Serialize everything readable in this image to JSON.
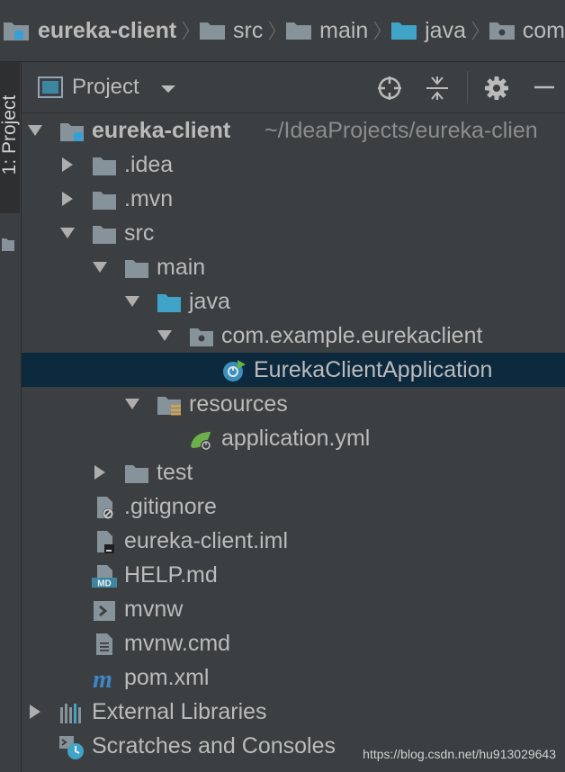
{
  "breadcrumb": {
    "items": [
      {
        "label": "eureka-client",
        "icon": "module-folder-icon"
      },
      {
        "label": "src",
        "icon": "folder-icon"
      },
      {
        "label": "main",
        "icon": "folder-icon"
      },
      {
        "label": "java",
        "icon": "source-folder-icon"
      },
      {
        "label": "com",
        "icon": "package-icon"
      }
    ]
  },
  "tool_window": {
    "tab_label": "1: Project"
  },
  "project_header": {
    "title": "Project",
    "buttons": [
      "locate-icon",
      "collapse-all-icon",
      "gear-icon",
      "hide-icon"
    ]
  },
  "tree": {
    "root": {
      "label": "eureka-client",
      "path": "~/IdeaProjects/eureka-clien"
    },
    "idea": ".idea",
    "mvn": ".mvn",
    "src": "src",
    "main": "main",
    "java": "java",
    "package": "com.example.eurekaclient",
    "app_class": "EurekaClientApplication",
    "resources": "resources",
    "app_yml": "application.yml",
    "test": "test",
    "gitignore": ".gitignore",
    "iml": "eureka-client.iml",
    "help": "HELP.md",
    "mvnw": "mvnw",
    "mvnw_cmd": "mvnw.cmd",
    "pom": "pom.xml",
    "ext_libs": "External Libraries",
    "scratches": "Scratches and Consoles"
  },
  "watermark": "https://blog.csdn.net/hu913029643",
  "colors": {
    "background": "#3c3f41",
    "selection": "#0d293e",
    "text": "#bbbbbb",
    "folder": "#87939a",
    "source_folder": "#40a4c8",
    "module_mark": "#389fd6",
    "spring_green": "#6bb04a"
  }
}
